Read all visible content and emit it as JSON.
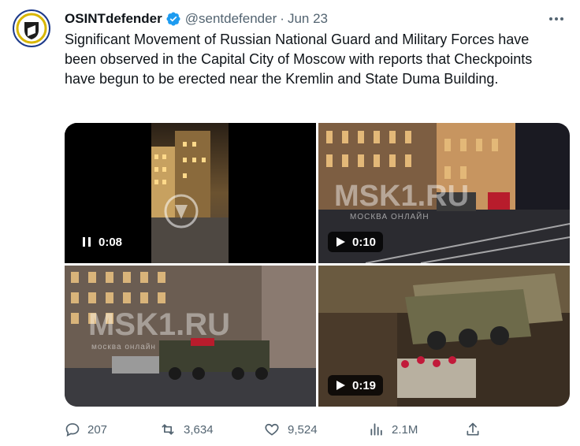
{
  "tweet": {
    "author_name": "OSINTdefender",
    "handle": "@sentdefender",
    "separator": "·",
    "date": "Jun 23",
    "text": "Significant Movement of Russian National Guard and Military Forces have been observed in the Capital City of Moscow with reports that Checkpoints have begun to be erected near the Kremlin and State Duma Building."
  },
  "videos": [
    {
      "state": "pause",
      "time": "0:08",
      "icon": "pause-icon"
    },
    {
      "state": "play",
      "time": "0:10",
      "icon": "play-icon",
      "watermark": "MSK1.RU",
      "watermark_sub": "МОСКВА ОНЛАЙН"
    },
    {
      "state": "play",
      "time": "",
      "icon": "",
      "watermark": "MSK1.RU",
      "watermark_sub": "москва онлайн"
    },
    {
      "state": "play",
      "time": "0:19",
      "icon": "play-icon"
    }
  ],
  "actions": {
    "replies": "207",
    "retweets": "3,634",
    "likes": "9,524",
    "views": "2.1M"
  },
  "colors": {
    "verified": "#1d9bf0",
    "secondary_text": "#536471",
    "watermark_red": "#e1232e"
  }
}
